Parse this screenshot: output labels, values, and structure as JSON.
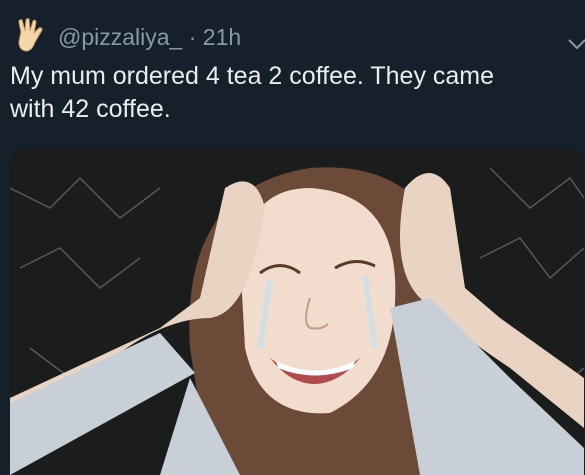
{
  "tweet": {
    "handle": "@pizzaliya_",
    "separator": "·",
    "time": "21h",
    "text_lines": [
      "My mum ordered 4 tea 2 coffee.  They came",
      "with 42 coffee."
    ]
  },
  "icons": {
    "avatar": "raised-hand-emoji",
    "menu": "chevron-down-icon"
  },
  "media": {
    "description_icon": "meme-image"
  },
  "colors": {
    "background": "#15202b",
    "secondary_text": "#8899a6",
    "primary_text": "#e9edf0"
  }
}
